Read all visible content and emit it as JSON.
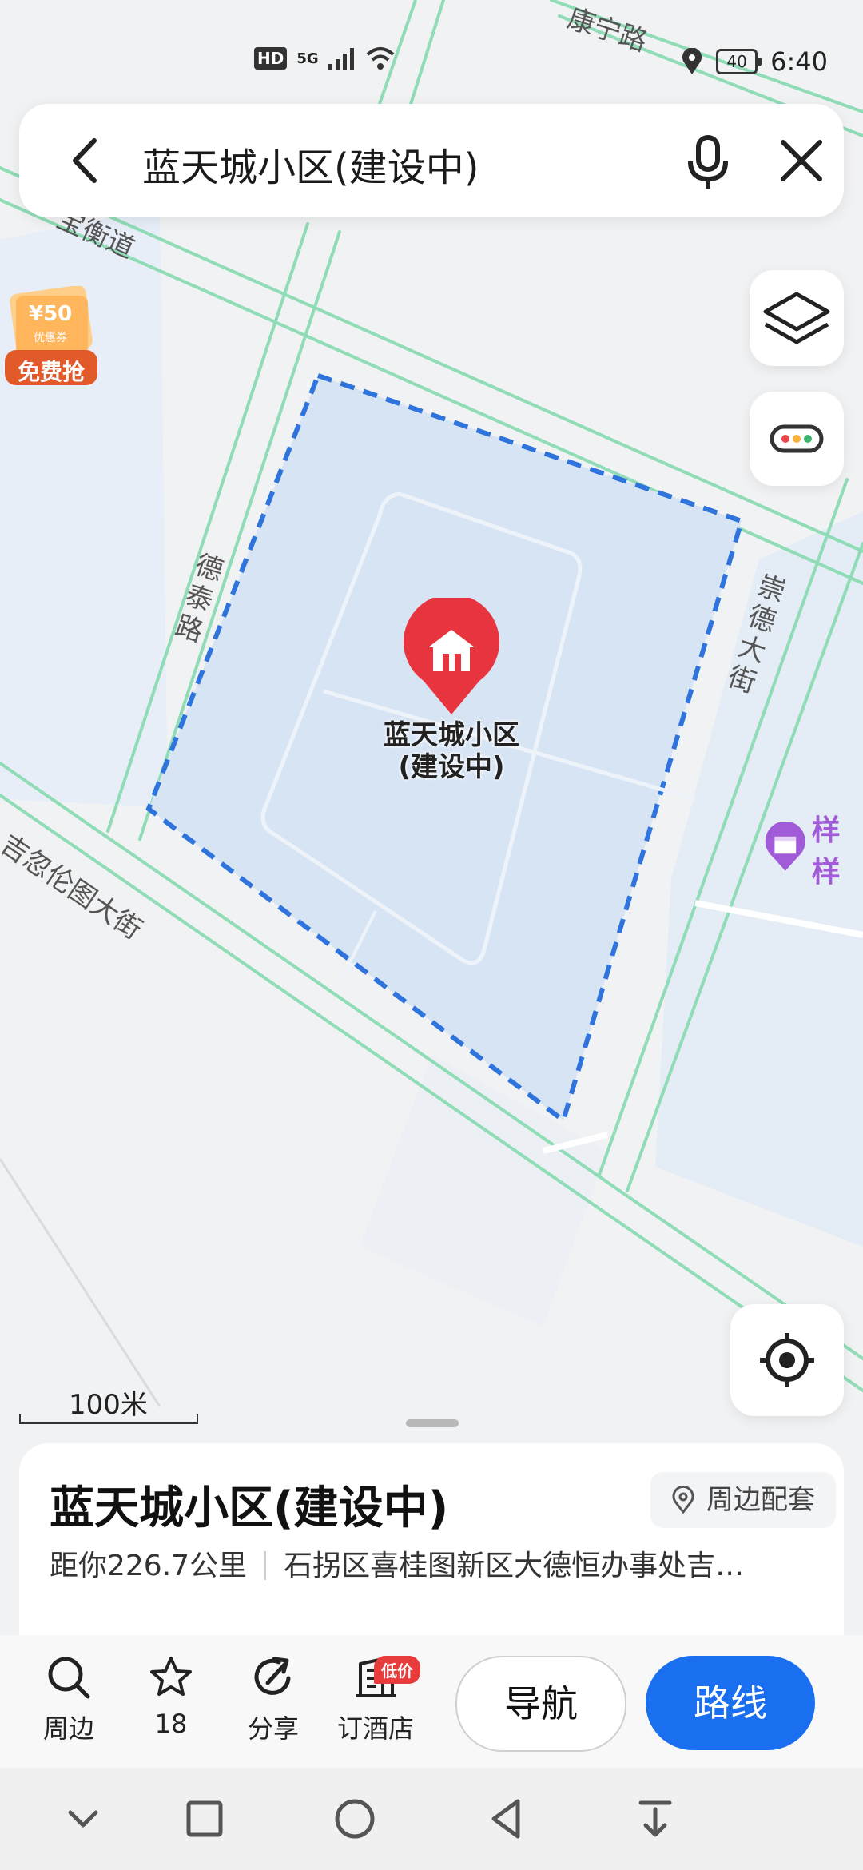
{
  "status_bar": {
    "hd": "HD",
    "network": "5G",
    "battery": "40",
    "time": "6:40"
  },
  "search": {
    "query": "蓝天城小区(建设中)"
  },
  "map": {
    "roads": [
      "康宁路",
      "宝衡道",
      "德泰路",
      "崇德大街",
      "吉忽伦图大街"
    ],
    "marker_label_line1": "蓝天城小区",
    "marker_label_line2": "(建设中)",
    "poi_partial": "样样",
    "coupon": {
      "amount": "¥50",
      "sub": "优惠券",
      "cta": "免费抢"
    },
    "scale": "100米"
  },
  "place_card": {
    "title": "蓝天城小区(建设中)",
    "nearby_button": "周边配套",
    "distance": "距你226.7公里",
    "address": "石拐区喜桂图新区大德恒办事处吉…"
  },
  "actions": {
    "nearby": "周边",
    "favorite_count": "18",
    "share": "分享",
    "hotel": "订酒店",
    "hotel_badge": "低价",
    "navigate": "导航",
    "route": "路线"
  },
  "colors": {
    "accent": "#1a6ff0",
    "marker": "#e8343f",
    "road": "#8fdcb6",
    "area_fill": "#d7e4f4"
  }
}
